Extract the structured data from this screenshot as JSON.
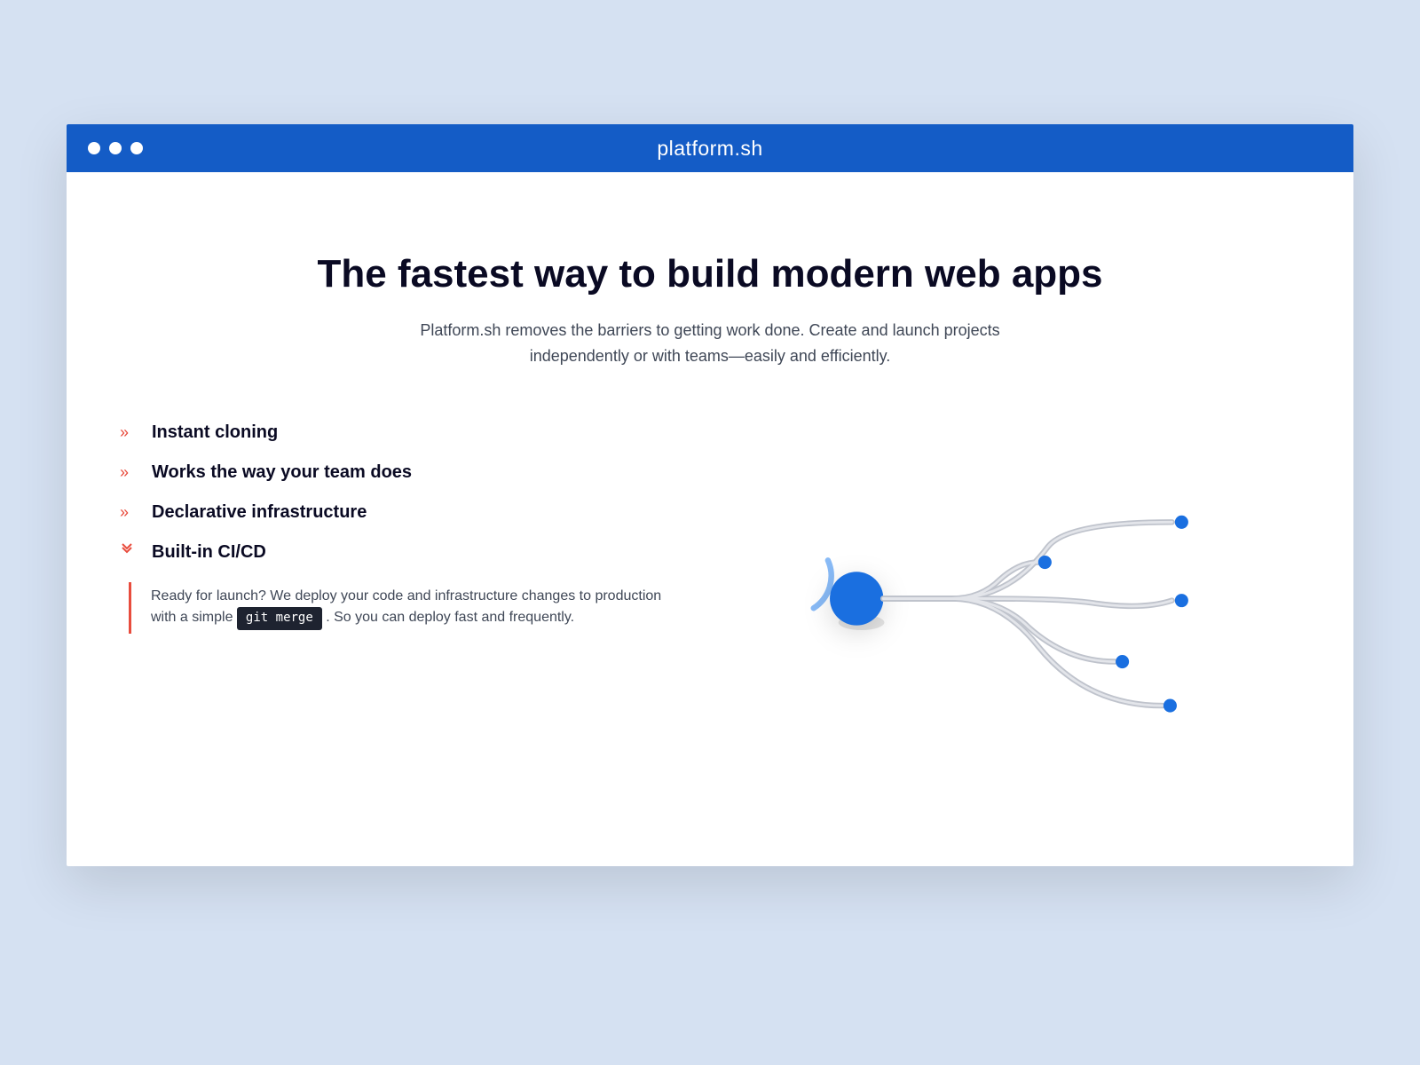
{
  "window": {
    "title": "platform.sh"
  },
  "hero": {
    "title": "The fastest way to build modern web apps",
    "subtitle": "Platform.sh removes the barriers to getting work done. Create and launch projects independently or with teams—easily and efficiently."
  },
  "features": {
    "items": [
      {
        "label": "Instant cloning",
        "expanded": false
      },
      {
        "label": "Works the way your team does",
        "expanded": false
      },
      {
        "label": "Declarative infrastructure",
        "expanded": false
      },
      {
        "label": "Built-in CI/CD",
        "expanded": true
      }
    ],
    "expanded_detail": {
      "pre": "Ready for launch? We deploy your code and infrastructure changes to production with a simple ",
      "code": "git merge",
      "post": ". So you can deploy fast and frequently."
    }
  },
  "colors": {
    "accent_blue": "#145cc6",
    "accent_red": "#e84c3d",
    "bg_page": "#d5e1f2",
    "text_dark": "#0a0a23"
  }
}
